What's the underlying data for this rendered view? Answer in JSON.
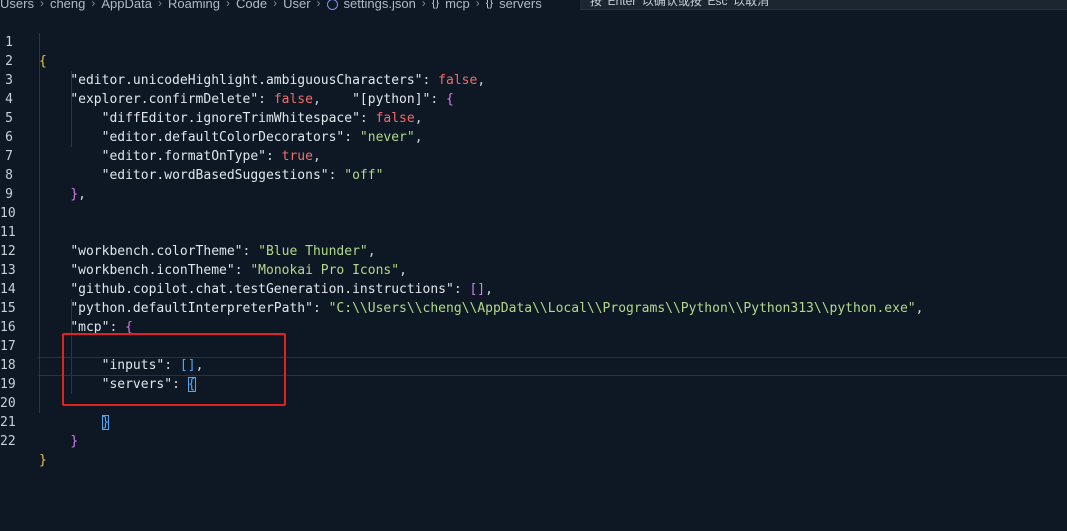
{
  "breadcrumb": {
    "items": [
      "Users",
      "cheng",
      "AppData",
      "Roaming",
      "Code",
      "User",
      "settings.json",
      "mcp",
      "servers"
    ]
  },
  "hint": {
    "text": "按 'Enter' 以确认或按 'Esc' 以取消"
  },
  "editor": {
    "lines": [
      {
        "n": "1"
      },
      {
        "n": "2"
      },
      {
        "n": "3"
      },
      {
        "n": "4"
      },
      {
        "n": "5"
      },
      {
        "n": "6"
      },
      {
        "n": "7"
      },
      {
        "n": "8"
      },
      {
        "n": "9"
      },
      {
        "n": "10"
      },
      {
        "n": "11"
      },
      {
        "n": "12"
      },
      {
        "n": "13"
      },
      {
        "n": "14"
      },
      {
        "n": "15"
      },
      {
        "n": "16"
      },
      {
        "n": "17"
      },
      {
        "n": "18"
      },
      {
        "n": "19"
      },
      {
        "n": "20"
      },
      {
        "n": "21"
      },
      {
        "n": "22"
      }
    ],
    "code": {
      "l1_open": "{",
      "l2_key": "\"editor.unicodeHighlight.ambiguousCharacters\"",
      "l2_val": "false",
      "l3_key": "\"explorer.confirmDelete\"",
      "l3_val": "false",
      "l3_key2": "\"[python]\"",
      "l3_open": "{",
      "l4_key": "\"diffEditor.ignoreTrimWhitespace\"",
      "l4_val": "false",
      "l5_key": "\"editor.defaultColorDecorators\"",
      "l5_val": "\"never\"",
      "l6_key": "\"editor.formatOnType\"",
      "l6_val": "true",
      "l7_key": "\"editor.wordBasedSuggestions\"",
      "l7_val": "\"off\"",
      "l8_close": "}",
      "l11_key": "\"workbench.colorTheme\"",
      "l11_val": "\"Blue Thunder\"",
      "l12_key": "\"workbench.iconTheme\"",
      "l12_val": "\"Monokai Pro Icons\"",
      "l13_key": "\"github.copilot.chat.testGeneration.instructions\"",
      "l13_val": "[]",
      "l14_key": "\"python.defaultInterpreterPath\"",
      "l14_val": "\"C:\\\\Users\\\\cheng\\\\AppData\\\\Local\\\\Programs\\\\Python\\\\Python313\\\\python.exe\"",
      "l15_key": "\"mcp\"",
      "l15_open": "{",
      "l17_key": "\"inputs\"",
      "l17_val": "[]",
      "l18_key": "\"servers\"",
      "l18_open": "{",
      "l20_close": "}",
      "l21_close": "}",
      "l22_close": "}"
    }
  },
  "colors": {
    "background": "#0d1824",
    "string": "#b2d88a",
    "keyword": "#f36b6b",
    "highlight_box": "#e0231f"
  }
}
